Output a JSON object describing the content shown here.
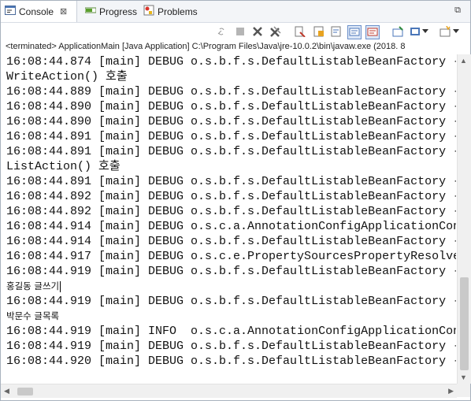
{
  "tabs": {
    "console": "Console",
    "close_glyph": "⊠",
    "progress": "Progress",
    "problems": "Problems",
    "restore_glyph": "⧉"
  },
  "toolbar": {
    "icons": [
      "link-icon",
      "terminate-icon",
      "remove-launch-icon",
      "remove-all-icon",
      "clear-console-icon",
      "scroll-lock-icon",
      "word-wrap-icon",
      "show-on-stdout-icon",
      "show-on-stderr-icon",
      "pin-console-icon",
      "display-console-icon",
      "dropdown-icon",
      "new-console-icon",
      "dropdown-icon"
    ]
  },
  "status_line": "<terminated> ApplicationMain [Java Application] C:\\Program Files\\Java\\jre-10.0.2\\bin\\javaw.exe (2018. 8",
  "console_lines": [
    "16:08:44.874 [main] DEBUG o.s.b.f.s.DefaultListableBeanFactory -",
    "WriteAction() 호출",
    "16:08:44.889 [main] DEBUG o.s.b.f.s.DefaultListableBeanFactory -",
    "16:08:44.890 [main] DEBUG o.s.b.f.s.DefaultListableBeanFactory -",
    "16:08:44.890 [main] DEBUG o.s.b.f.s.DefaultListableBeanFactory -",
    "16:08:44.891 [main] DEBUG o.s.b.f.s.DefaultListableBeanFactory -",
    "16:08:44.891 [main] DEBUG o.s.b.f.s.DefaultListableBeanFactory -",
    "ListAction() 호출",
    "16:08:44.891 [main] DEBUG o.s.b.f.s.DefaultListableBeanFactory -",
    "16:08:44.892 [main] DEBUG o.s.b.f.s.DefaultListableBeanFactory -",
    "16:08:44.892 [main] DEBUG o.s.b.f.s.DefaultListableBeanFactory -",
    "16:08:44.914 [main] DEBUG o.s.c.a.AnnotationConfigApplicationCon",
    "16:08:44.914 [main] DEBUG o.s.b.f.s.DefaultListableBeanFactory -",
    "16:08:44.917 [main] DEBUG o.s.c.e.PropertySourcesPropertyResolve",
    "16:08:44.919 [main] DEBUG o.s.b.f.s.DefaultListableBeanFactory -",
    "홍길동 글쓰기",
    "16:08:44.919 [main] DEBUG o.s.b.f.s.DefaultListableBeanFactory -",
    "박문수 글목록",
    "16:08:44.919 [main] INFO  o.s.c.a.AnnotationConfigApplicationCon",
    "16:08:44.919 [main] DEBUG o.s.b.f.s.DefaultListableBeanFactory -",
    "16:08:44.920 [main] DEBUG o.s.b.f.s.DefaultListableBeanFactory -"
  ],
  "colors": {
    "tab_bg": "#f3f5f8",
    "scrollbar": "#f0f0f0",
    "thumb": "#c9c9c9"
  }
}
